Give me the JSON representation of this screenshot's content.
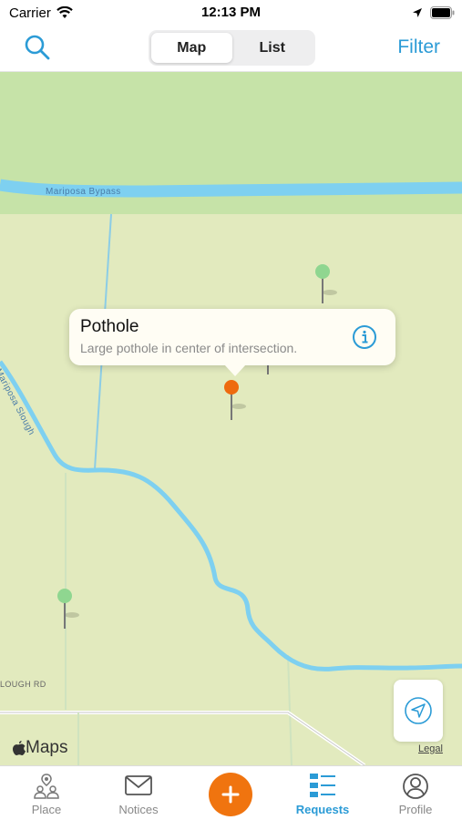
{
  "status_bar": {
    "carrier": "Carrier",
    "time": "12:13 PM"
  },
  "nav": {
    "segments": [
      "Map",
      "List"
    ],
    "selected_segment": "Map",
    "filter_label": "Filter"
  },
  "map": {
    "road_labels": {
      "bypass": "Mariposa Bypass",
      "slough": "Mariposa Slough",
      "lough_rd": "LOUGH RD"
    },
    "callout": {
      "title": "Pothole",
      "subtitle": "Large pothole in center of intersection."
    },
    "attribution": {
      "logo_text": "Maps",
      "legal": "Legal"
    },
    "pin_colors": {
      "selected": "#ee6a0e",
      "other": "#8fd690"
    }
  },
  "tabs": [
    {
      "label": "Place",
      "icon": "place-icon"
    },
    {
      "label": "Notices",
      "icon": "mail-icon"
    },
    {
      "label": "",
      "icon": "plus-icon"
    },
    {
      "label": "Requests",
      "icon": "list-icon"
    },
    {
      "label": "Profile",
      "icon": "profile-icon"
    }
  ],
  "active_tab": "Requests",
  "colors": {
    "accent": "#2b9bd6",
    "add_button": "#f0740f",
    "map_land": "#e2eabe",
    "map_park": "#c6e3a8",
    "water": "#7ed0f0"
  }
}
